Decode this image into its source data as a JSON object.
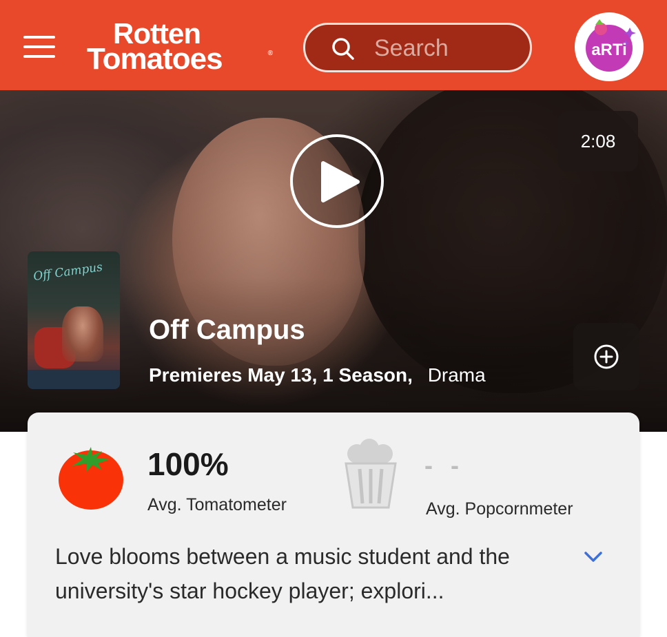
{
  "header": {
    "logo_line1": "Rotten",
    "logo_line2": "Tomatoes",
    "logo_reg": "®",
    "search_placeholder": "Search",
    "avatar_text": "aRTi",
    "brand_color": "#e8492a"
  },
  "hero": {
    "video_duration": "2:08",
    "poster_title": "Off Campus",
    "title": "Off Campus",
    "premiere": "Premieres May 13,",
    "seasons": "1 Season,",
    "genre": "Drama"
  },
  "scores": {
    "tomatometer": {
      "value": "100%",
      "label": "Avg. Tomatometer"
    },
    "popcornmeter": {
      "value": "- -",
      "label": "Avg. Popcornmeter"
    }
  },
  "synopsis": {
    "text": "Love blooms between a music student and the university's star hockey player; explori..."
  },
  "icons": {
    "menu": "hamburger-menu-icon",
    "search": "search-icon",
    "play": "play-icon",
    "add": "plus-circle-icon",
    "tomato": "tomato-icon",
    "popcorn": "popcorn-bucket-icon",
    "expand": "chevron-down-icon"
  }
}
